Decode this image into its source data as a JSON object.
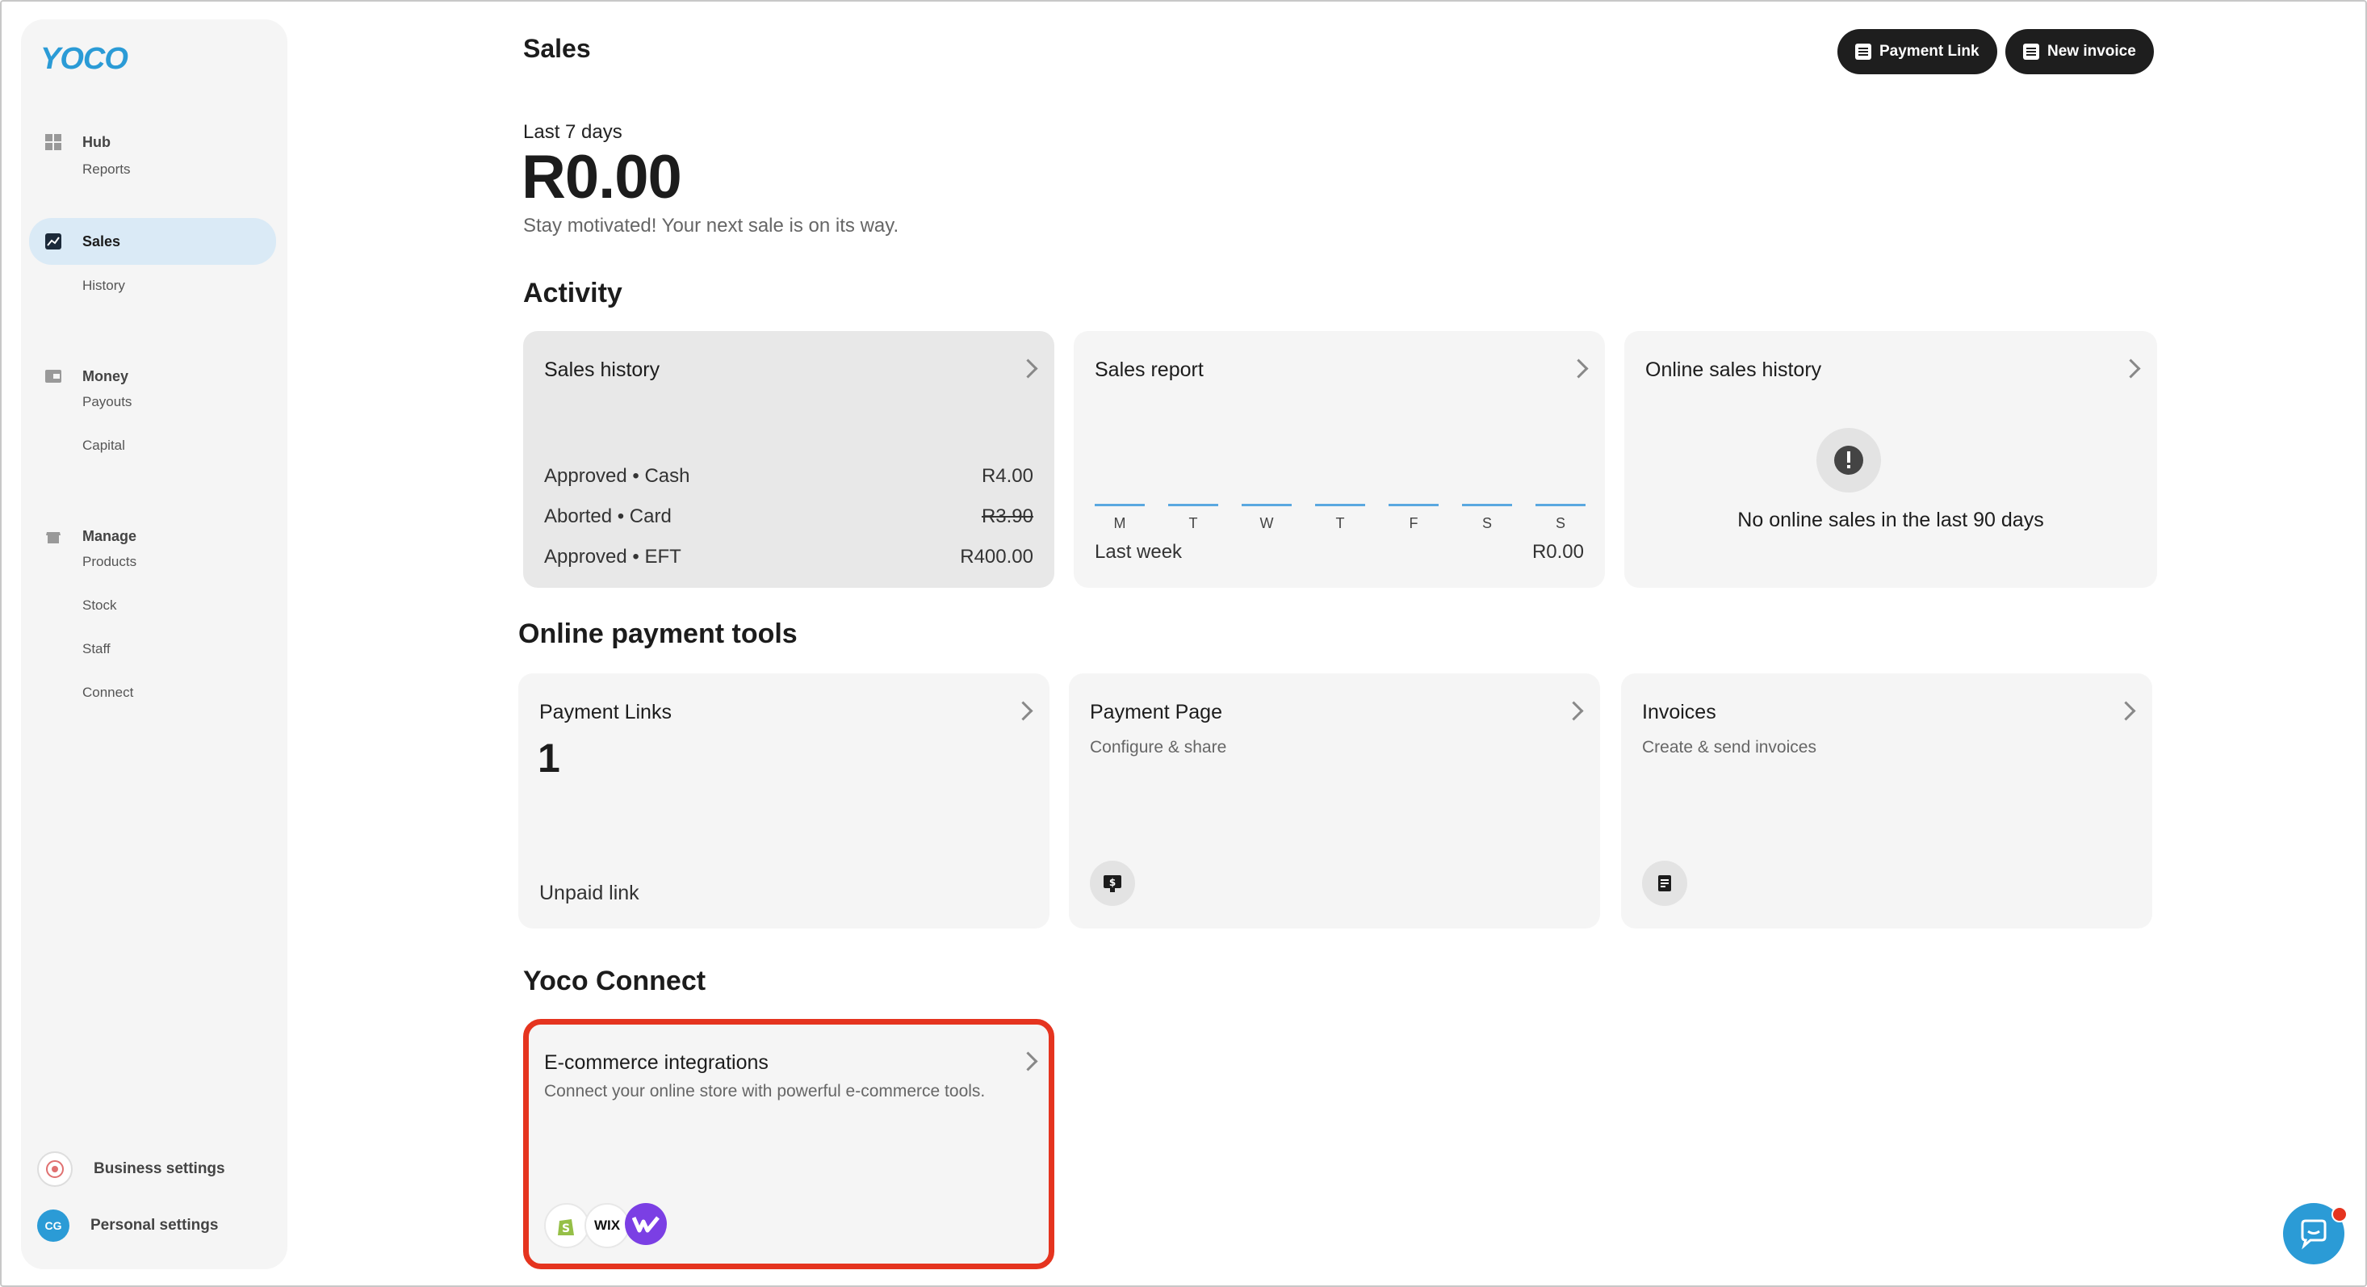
{
  "sidebar": {
    "logo": "YOCO",
    "hub": "Hub",
    "reports": "Reports",
    "sales": "Sales",
    "history": "History",
    "money": "Money",
    "payouts": "Payouts",
    "capital": "Capital",
    "manage": "Manage",
    "products": "Products",
    "stock": "Stock",
    "staff": "Staff",
    "connect": "Connect",
    "business_settings": "Business settings",
    "personal_settings": "Personal settings",
    "avatar_initials": "CG"
  },
  "header": {
    "title": "Sales",
    "payment_link_btn": "Payment Link",
    "new_invoice_btn": "New invoice"
  },
  "summary": {
    "period": "Last 7 days",
    "amount": "R0.00",
    "message": "Stay motivated! Your next sale is on its way."
  },
  "activity": {
    "title": "Activity",
    "sales_history": {
      "title": "Sales history",
      "rows": [
        {
          "label": "Approved • Cash",
          "value": "R4.00",
          "strike": false
        },
        {
          "label": "Aborted • Card",
          "value": "R3.90",
          "strike": true
        },
        {
          "label": "Approved • EFT",
          "value": "R400.00",
          "strike": false
        }
      ]
    },
    "sales_report": {
      "title": "Sales report",
      "days": [
        "M",
        "T",
        "W",
        "T",
        "F",
        "S",
        "S"
      ],
      "period_label": "Last week",
      "total": "R0.00"
    },
    "online_sales": {
      "title": "Online sales history",
      "message": "No online sales in the last 90 days"
    }
  },
  "tools": {
    "title": "Online payment tools",
    "payment_links": {
      "title": "Payment Links",
      "count": "1",
      "footer": "Unpaid link"
    },
    "payment_page": {
      "title": "Payment Page",
      "subtitle": "Configure & share"
    },
    "invoices": {
      "title": "Invoices",
      "subtitle": "Create & send invoices"
    }
  },
  "connect": {
    "title": "Yoco Connect",
    "ecommerce": {
      "title": "E-commerce integrations",
      "subtitle": "Connect your online store with powerful e-commerce tools.",
      "wix_label": "WIX"
    }
  },
  "colors": {
    "accent": "#2b9bd6",
    "highlight": "#e5341f",
    "active_nav": "#daeaf6"
  }
}
